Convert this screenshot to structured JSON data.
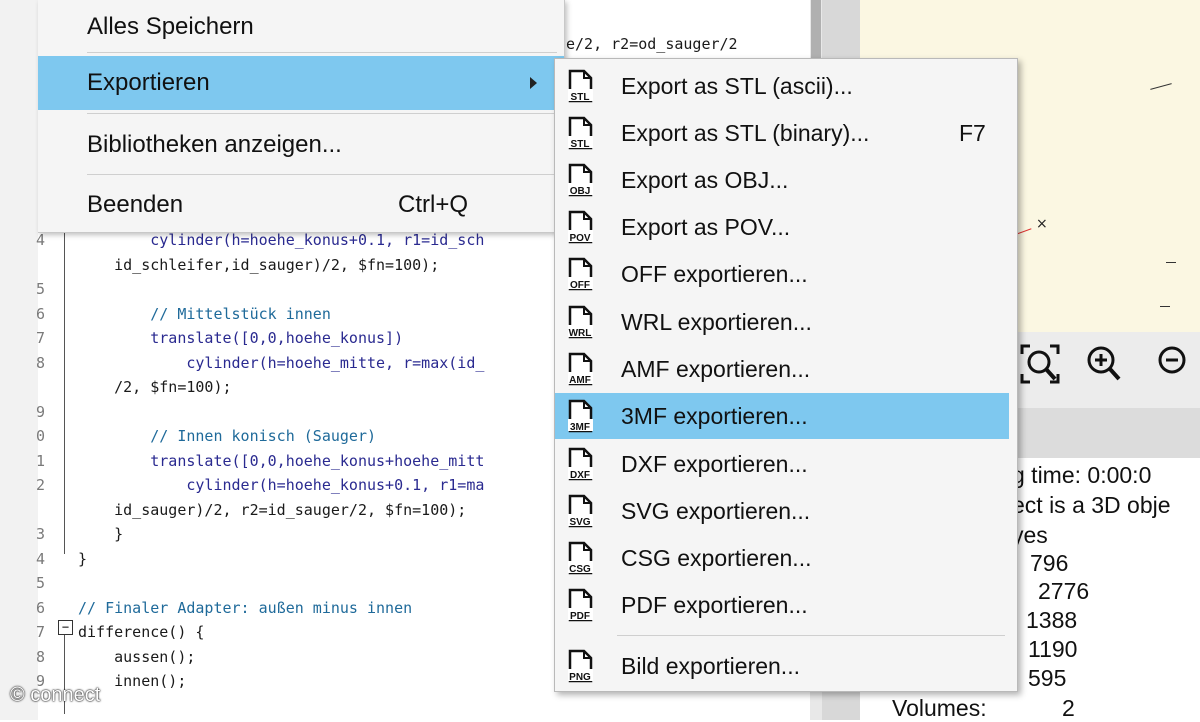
{
  "main_menu": {
    "items": [
      {
        "label": "Alles Speichern",
        "shortcut": ""
      },
      {
        "label": "Exportieren",
        "shortcut": ""
      },
      {
        "label": "Bibliotheken anzeigen...",
        "shortcut": ""
      },
      {
        "label": "Beenden",
        "shortcut": "Ctrl+Q"
      }
    ],
    "highlighted": "Exportieren"
  },
  "submenu": {
    "items": [
      {
        "label": "Export as STL (ascii)...",
        "icon": "stl-file-icon",
        "badge": "STL",
        "shortcut": ""
      },
      {
        "label": "Export as STL (binary)...",
        "icon": "stl-file-icon",
        "badge": "STL",
        "shortcut": "F7"
      },
      {
        "label": "Export as OBJ...",
        "icon": "obj-file-icon",
        "badge": "OBJ",
        "shortcut": ""
      },
      {
        "label": "Export as POV...",
        "icon": "pov-file-icon",
        "badge": "POV",
        "shortcut": ""
      },
      {
        "label": "OFF exportieren...",
        "icon": "off-file-icon",
        "badge": "OFF",
        "shortcut": ""
      },
      {
        "label": "WRL exportieren...",
        "icon": "wrl-file-icon",
        "badge": "WRL",
        "shortcut": ""
      },
      {
        "label": "AMF exportieren...",
        "icon": "amf-file-icon",
        "badge": "AMF",
        "shortcut": ""
      },
      {
        "label": "3MF exportieren...",
        "icon": "3mf-file-icon",
        "badge": "3MF",
        "shortcut": ""
      },
      {
        "label": "DXF exportieren...",
        "icon": "dxf-file-icon",
        "badge": "DXF",
        "shortcut": ""
      },
      {
        "label": "SVG exportieren...",
        "icon": "svg-file-icon",
        "badge": "SVG",
        "shortcut": ""
      },
      {
        "label": "CSG exportieren...",
        "icon": "csg-file-icon",
        "badge": "CSG",
        "shortcut": ""
      },
      {
        "label": "PDF exportieren...",
        "icon": "pdf-file-icon",
        "badge": "PDF",
        "shortcut": ""
      },
      {
        "label": "Bild exportieren...",
        "icon": "png-file-icon",
        "badge": "PNG",
        "shortcut": ""
      }
    ],
    "highlighted": "3MF exportieren..."
  },
  "editor": {
    "top_fragment": "e/2, r2=od_sauger/2",
    "lines": [
      {
        "n": "4",
        "text": "        cylinder(h=hoehe_konus+0.1, r1=id_sch"
      },
      {
        "n": "",
        "text": "    id_schleifer,id_sauger)/2, $fn=100);"
      },
      {
        "n": "5",
        "text": ""
      },
      {
        "n": "6",
        "text": "        // Mittelstück innen"
      },
      {
        "n": "7",
        "text": "        translate([0,0,hoehe_konus])"
      },
      {
        "n": "8",
        "text": "            cylinder(h=hoehe_mitte, r=max(id_"
      },
      {
        "n": "",
        "text": "    /2, $fn=100);"
      },
      {
        "n": "9",
        "text": ""
      },
      {
        "n": "0",
        "text": "        // Innen konisch (Sauger)"
      },
      {
        "n": "1",
        "text": "        translate([0,0,hoehe_konus+hoehe_mitt"
      },
      {
        "n": "2",
        "text": "            cylinder(h=hoehe_konus+0.1, r1=ma"
      },
      {
        "n": "",
        "text": "    id_sauger)/2, r2=id_sauger/2, $fn=100);"
      },
      {
        "n": "3",
        "text": "    }"
      },
      {
        "n": "4",
        "text": "}"
      },
      {
        "n": "5",
        "text": ""
      },
      {
        "n": "6",
        "text": "// Finaler Adapter: außen minus innen"
      },
      {
        "n": "7",
        "text": "difference() {"
      },
      {
        "n": "8",
        "text": "    aussen();"
      },
      {
        "n": "9",
        "text": "    innen();"
      }
    ]
  },
  "console": {
    "lines": [
      "g time: 0:00:0",
      "ect is a 3D obje",
      "yes",
      "796",
      "2776",
      "1388",
      "1190",
      "595"
    ],
    "volumes_label": "Volumes:",
    "volumes_value": "2"
  },
  "watermark": "© connect",
  "colors": {
    "highlight": "#7ec8ef",
    "menu_bg": "#f5f5f5",
    "viewport_bg": "#fbf7e2"
  }
}
